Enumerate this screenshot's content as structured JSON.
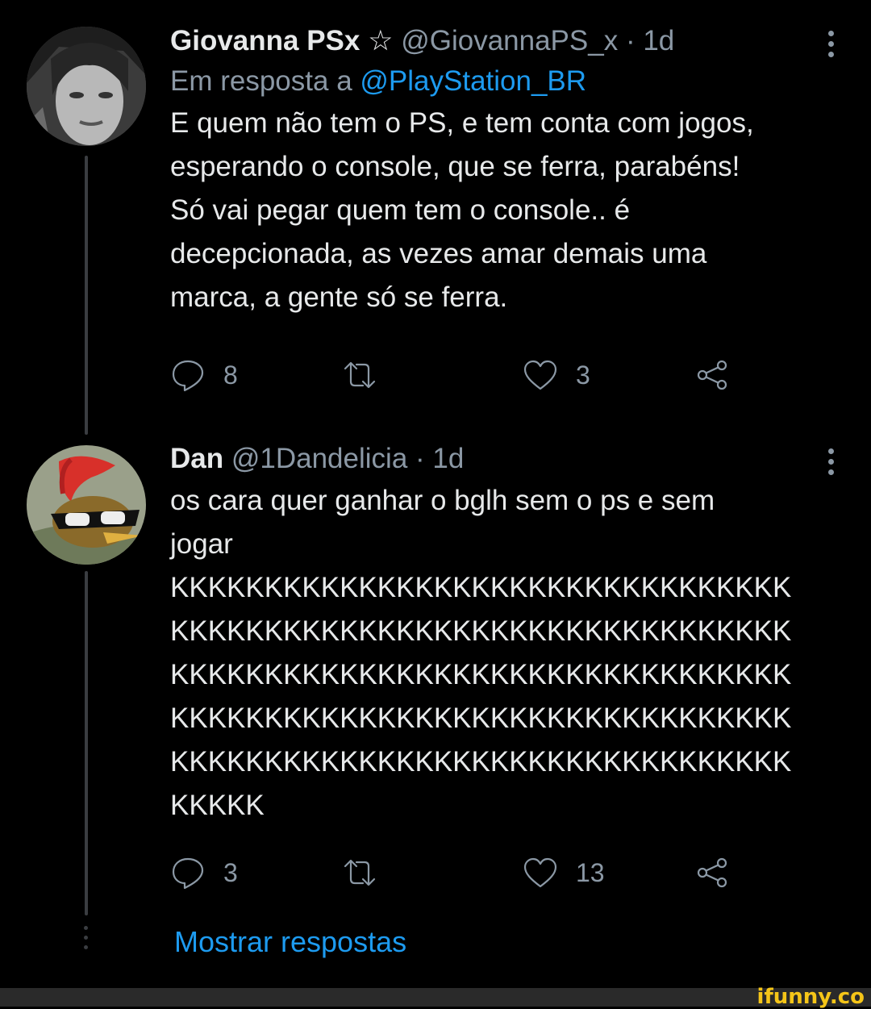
{
  "tweets": [
    {
      "name": "Giovanna PSx ☆",
      "handle": "@GiovannaPS_x",
      "separator": "·",
      "time": "1d",
      "reply_prefix": "Em resposta a ",
      "reply_mention": "@PlayStation_BR",
      "text": "E quem não tem o PS, e tem conta com jogos,\nesperando o console, que se ferra, parabéns!\nSó vai pegar quem tem o console.. é\ndecepcionada, as vezes amar demais uma\nmarca, a gente só se ferra.",
      "replies": "8",
      "retweets": "",
      "likes": "3",
      "avatar_icon": "user-avatar-photo"
    },
    {
      "name": "Dan",
      "handle": "@1Dandelicia",
      "separator": "·",
      "time": "1d",
      "text": "os cara quer ganhar o bglh sem o ps e sem\njogar\nKKKKKKKKKKKKKKKKKKKKKKKKKKKKKKKKK\nKKKKKKKKKKKKKKKKKKKKKKKKKKKKKKKKK\nKKKKKKKKKKKKKKKKKKKKKKKKKKKKKKKKK\nKKKKKKKKKKKKKKKKKKKKKKKKKKKKKKKKK\nKKKKKKKKKKKKKKKKKKKKKKKKKKKKKKKKK\nKKKKK",
      "replies": "3",
      "retweets": "",
      "likes": "13",
      "avatar_icon": "woody-woodpecker-avatar"
    }
  ],
  "show_replies": "Mostrar respostas",
  "watermark": "ifunny.co",
  "icons": {
    "reply": "reply-icon",
    "retweet": "retweet-icon",
    "like": "heart-icon",
    "share": "share-icon",
    "more": "more-vertical-icon"
  },
  "colors": {
    "background": "#000000",
    "text": "#e7e9ea",
    "secondary": "#8b98a5",
    "link": "#1d9bf0",
    "watermark": "#f5c518"
  }
}
